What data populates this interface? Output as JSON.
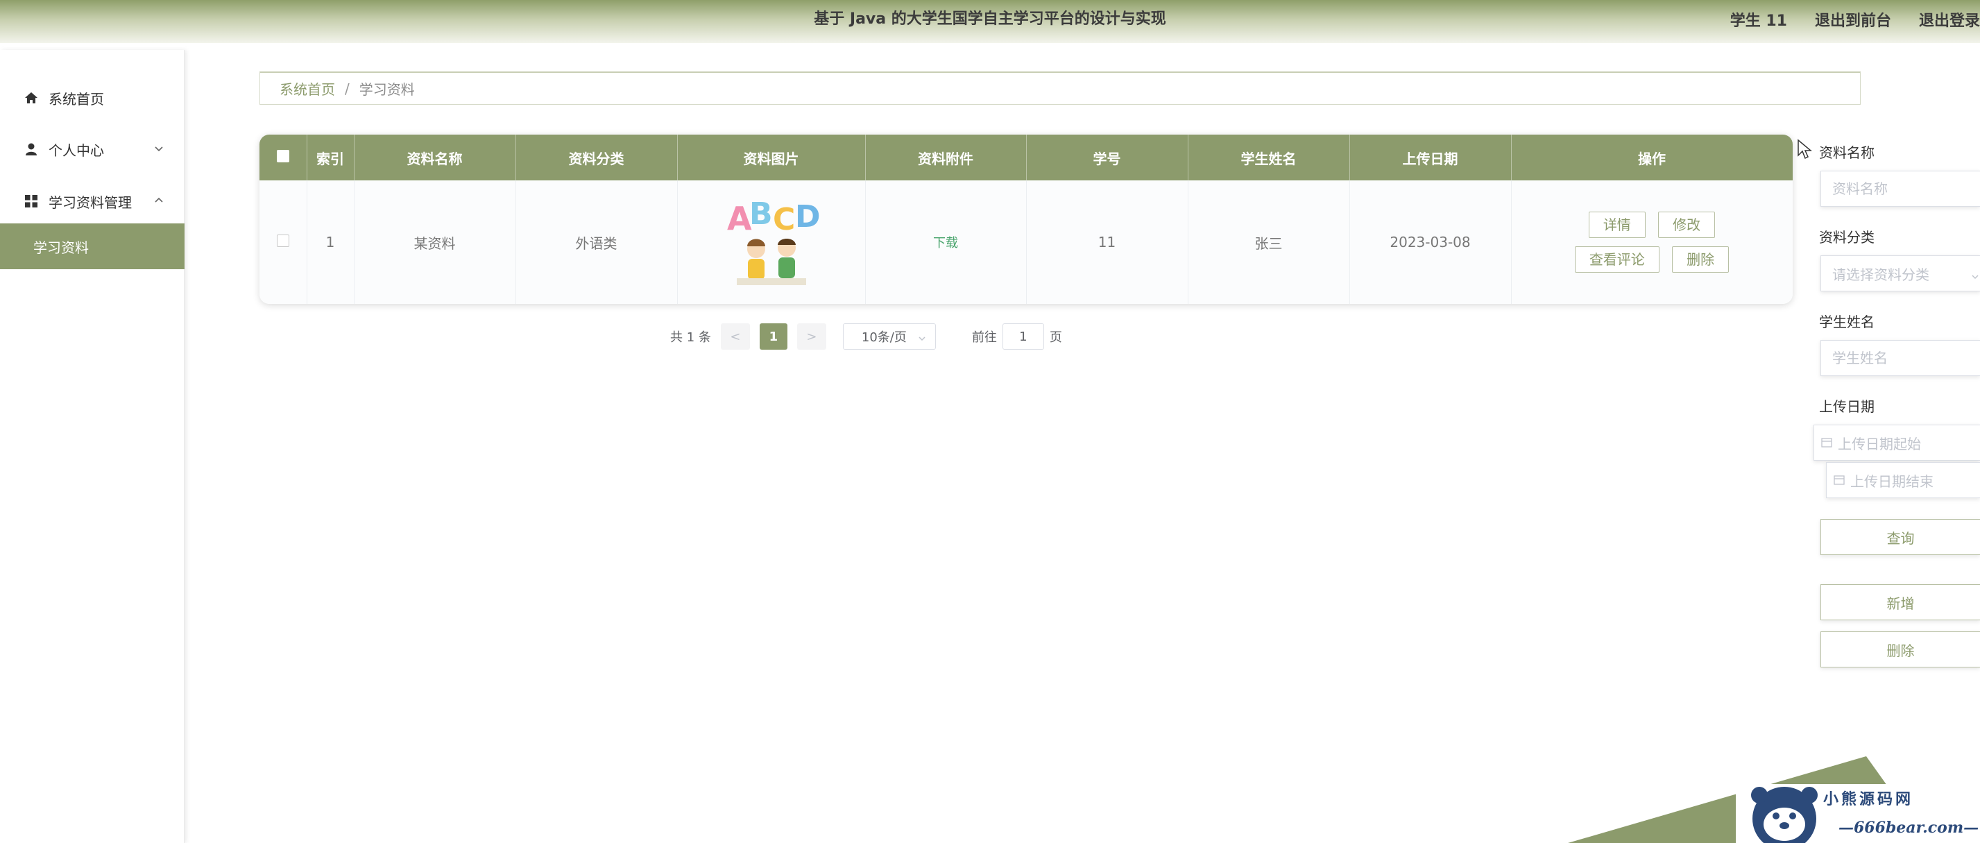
{
  "header": {
    "title": "基于 Java 的大学生国学自主学习平台的设计与实现",
    "username": "学生 11",
    "to_frontend": "退出到前台",
    "logout": "退出登录"
  },
  "sidebar": {
    "items": [
      {
        "label": "系统首页",
        "icon": "home-icon"
      },
      {
        "label": "个人中心",
        "icon": "user-icon",
        "expanded": false
      },
      {
        "label": "学习资料管理",
        "icon": "grid-icon",
        "expanded": true
      },
      {
        "label": "学习资料",
        "active": true
      }
    ]
  },
  "breadcrumb": {
    "home": "系统首页",
    "separator": "/",
    "current": "学习资料"
  },
  "table": {
    "headers": [
      "索引",
      "资料名称",
      "资料分类",
      "资料图片",
      "资料附件",
      "学号",
      "学生姓名",
      "上传日期",
      "操作"
    ],
    "rows": [
      {
        "index": "1",
        "name": "某资料",
        "category": "外语类",
        "image": "ABCD",
        "attachment": "下载",
        "student_id": "11",
        "student_name": "张三",
        "upload_date": "2023-03-08",
        "actions": {
          "detail": "详情",
          "edit": "修改",
          "comments": "查看评论",
          "delete": "删除"
        }
      }
    ]
  },
  "pagination": {
    "total_text": "共 1 条",
    "prev": "<",
    "current_page": "1",
    "next": ">",
    "page_size": "10条/页",
    "goto_label": "前往",
    "goto_value": "1",
    "page_unit": "页"
  },
  "search": {
    "name_label": "资料名称",
    "name_placeholder": "资料名称",
    "category_label": "资料分类",
    "category_placeholder": "请选择资料分类",
    "student_label": "学生姓名",
    "student_placeholder": "学生姓名",
    "date_label": "上传日期",
    "date_start_placeholder": "上传日期起始",
    "date_end_placeholder": "上传日期结束",
    "query_button": "查询",
    "add_button": "新增",
    "delete_button": "删除"
  },
  "watermark": {
    "name": "小熊源码网",
    "url": "—666bear.com—"
  },
  "colors": {
    "accent": "#8c9b6c",
    "download": "#47a36b",
    "watermark": "#2c4a7a"
  }
}
